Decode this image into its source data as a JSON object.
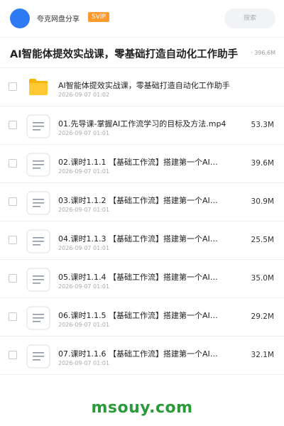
{
  "header": {
    "app_name": "夸克网盘分享",
    "badge": "SVIP",
    "search_placeholder": "搜索",
    "avatar_color": "#2f7bf6",
    "badge_color": "#ff9a2e"
  },
  "folder": {
    "title": "AI智能体提效实战课，零基础打造自动化工作助手",
    "total_size_suffix": "· 396.6M"
  },
  "items": [
    {
      "type": "folder",
      "icon": "folder-icon",
      "name": "AI智能体提效实战课，零基础打造自动化工作助手",
      "date": "2026-09-07 01:02",
      "size": ""
    },
    {
      "type": "file",
      "icon": "document-icon",
      "name": "01.先导课-掌握AI工作流学习的目标及方法.mp4",
      "date": "2026-09-07 01:01",
      "size": "53.3M"
    },
    {
      "type": "file",
      "icon": "document-icon",
      "name": "02.课时1.1.1 【基础工作流】搭建第一个AI…",
      "date": "2026-09-07 01:01",
      "size": "39.6M"
    },
    {
      "type": "file",
      "icon": "document-icon",
      "name": "03.课时1.1.2 【基础工作流】搭建第一个AI…",
      "date": "2026-09-07 01:01",
      "size": "30.9M"
    },
    {
      "type": "file",
      "icon": "document-icon",
      "name": "04.课时1.1.3 【基础工作流】搭建第一个AI…",
      "date": "2026-09-07 01:01",
      "size": "25.5M"
    },
    {
      "type": "file",
      "icon": "document-icon",
      "name": "05.课时1.1.4 【基础工作流】搭建第一个AI…",
      "date": "2026-09-07 01:01",
      "size": "35.0M"
    },
    {
      "type": "file",
      "icon": "document-icon",
      "name": "06.课时1.1.5 【基础工作流】搭建第一个AI…",
      "date": "2026-09-07 01:01",
      "size": "29.2M"
    },
    {
      "type": "file",
      "icon": "document-icon",
      "name": "07.课时1.1.6 【基础工作流】搭建第一个AI…",
      "date": "2026-09-07 01:01",
      "size": "32.1M"
    }
  ],
  "watermark": "msouy.com",
  "watermark_color": "#2a9a3a"
}
